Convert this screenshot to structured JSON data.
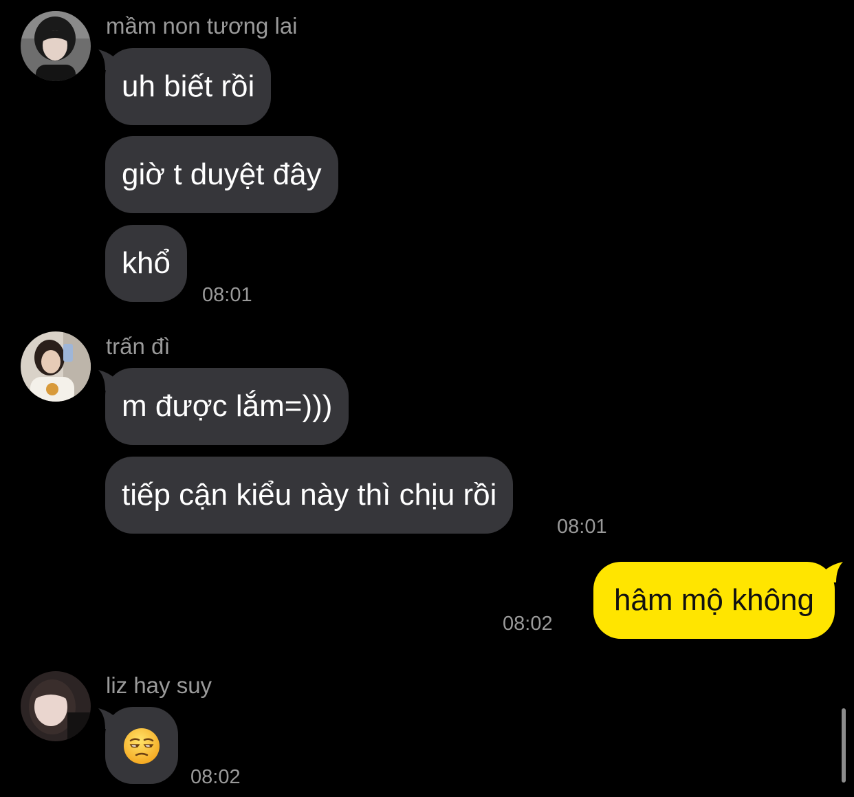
{
  "colors": {
    "background": "#000000",
    "incoming_bubble": "#36363a",
    "outgoing_bubble": "#ffe500",
    "meta_text": "#9a9a9a"
  },
  "groups": [
    {
      "sender": "mầm non tương lai",
      "avatar_icon": "avatar-photo",
      "messages": [
        "uh biết rồi",
        "giờ t duyệt đây",
        "khổ"
      ],
      "time": "08:01"
    },
    {
      "sender": "trấn đì",
      "avatar_icon": "avatar-photo",
      "messages": [
        "m được lắm=)))",
        "tiếp cận kiểu này thì chịu rồi"
      ],
      "time": "08:01"
    },
    {
      "sender": "liz hay suy",
      "avatar_icon": "avatar-photo",
      "emoji_icon": "unamused-face-emoji",
      "time": "08:02"
    }
  ],
  "own_message": {
    "text": "hâm mộ không",
    "time": "08:02"
  }
}
